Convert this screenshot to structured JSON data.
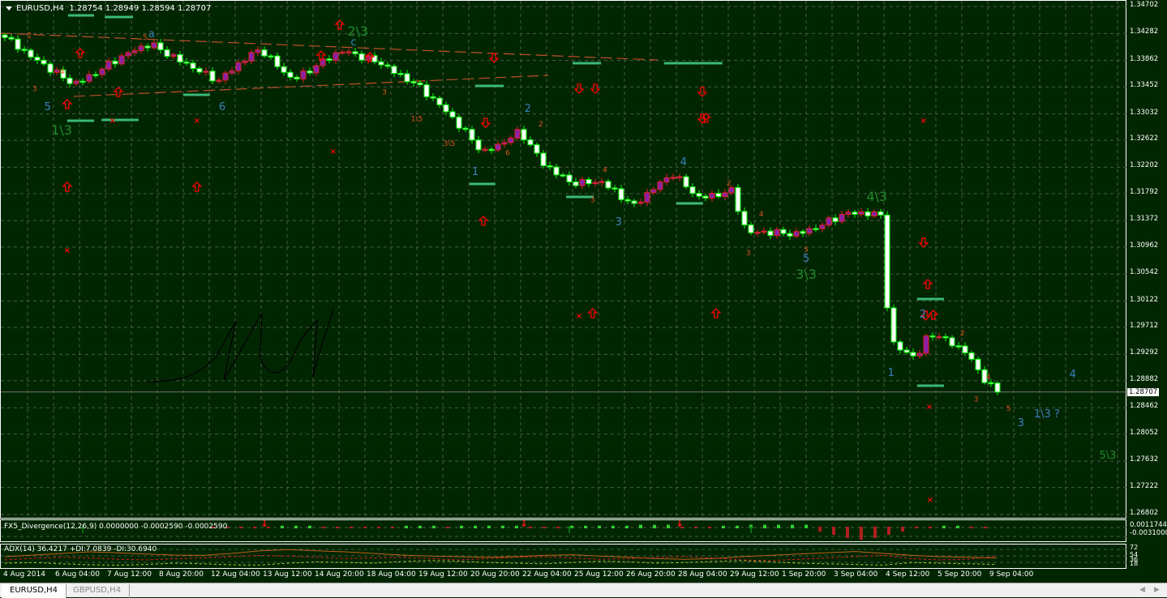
{
  "header": {
    "symbol": "EURUSD,H4",
    "ohlc": "1.28754 1.28949 1.28594 1.28707"
  },
  "price_axis": {
    "labels": [
      "1.34702",
      "1.34282",
      "1.33862",
      "1.33452",
      "1.33032",
      "1.32622",
      "1.32202",
      "1.31792",
      "1.31372",
      "1.30962",
      "1.30542",
      "1.30122",
      "1.29712",
      "1.29292",
      "1.28882",
      "1.28462",
      "1.28052",
      "1.27632",
      "1.27222",
      "1.26802"
    ],
    "current": "1.28707"
  },
  "divergence": {
    "label": "FX5_Divergence(12,26,9) 0.0000000 -0.0002590 -0.0002590",
    "axis": [
      "0.0011744",
      "-0.0031000"
    ],
    "hist": [
      0,
      -1,
      -1,
      0,
      -1,
      1,
      1,
      1,
      -1,
      -1,
      0,
      -1,
      -1,
      -1,
      1,
      1,
      1,
      0,
      1,
      1,
      1,
      1,
      1,
      -1,
      -1,
      -1,
      1,
      1,
      1,
      1,
      1,
      2,
      2,
      2,
      -1,
      -1,
      -1,
      1,
      1,
      2,
      2,
      2,
      2,
      2,
      -3,
      -5,
      -7,
      -8,
      -7,
      -5,
      -3,
      -1,
      0,
      1,
      1,
      -1,
      -1
    ],
    "arrows": [
      {
        "dir": "up",
        "bar": 12
      },
      {
        "dir": "down",
        "bar": 40
      },
      {
        "dir": "down",
        "bar": 80
      },
      {
        "dir": "up",
        "bar": 87
      },
      {
        "dir": "down",
        "bar": 104
      },
      {
        "dir": "up",
        "bar": 115
      }
    ]
  },
  "adx": {
    "label": "ADX(14) 36.4217 +DI:7.0839 -DI:30.6940",
    "axis": [
      "72",
      "54",
      "36",
      "18"
    ],
    "adx_line": [
      40,
      45,
      50,
      55,
      52,
      48,
      45,
      44,
      50,
      58,
      62,
      58,
      55,
      50,
      45,
      42,
      40,
      38,
      40,
      44,
      46,
      42,
      38,
      34,
      32,
      34,
      40,
      44,
      48,
      52,
      56,
      50,
      44,
      40,
      38,
      36
    ],
    "plus_di": [
      20,
      22,
      18,
      15,
      14,
      16,
      20,
      18,
      15,
      14,
      20,
      24,
      22,
      20,
      25,
      28,
      26,
      22,
      20,
      18,
      22,
      26,
      24,
      20,
      22,
      25,
      28,
      24,
      20,
      18,
      16,
      14,
      22,
      20,
      18,
      16
    ],
    "minus_di": [
      30,
      35,
      38,
      36,
      32,
      30,
      34,
      36,
      40,
      44,
      42,
      38,
      34,
      36,
      38,
      34,
      30,
      34,
      38,
      40,
      36,
      32,
      34,
      38,
      40,
      36,
      30,
      28,
      32,
      36,
      40,
      44,
      34,
      30,
      32,
      42
    ]
  },
  "time_axis": [
    "4 Aug 2014",
    "6 Aug 04:00",
    "7 Aug 12:00",
    "8 Aug 20:00",
    "12 Aug 04:00",
    "13 Aug 12:00",
    "14 Aug 20:00",
    "18 Aug 04:00",
    "19 Aug 12:00",
    "20 Aug 20:00",
    "22 Aug 04:00",
    "25 Aug 12:00",
    "26 Aug 20:00",
    "28 Aug 04:00",
    "29 Aug 12:00",
    "1 Sep 20:00",
    "3 Sep 04:00",
    "4 Sep 12:00",
    "5 Sep 20:00",
    "9 Sep 04:00"
  ],
  "tabs": [
    {
      "label": "EURUSD,H4",
      "active": true
    },
    {
      "label": "GBPUSD,H4",
      "active": false
    }
  ],
  "colors": {
    "bg": "#002600",
    "bull": "#8a1fa8",
    "bear": "#ffffff",
    "wick": "#00ff00",
    "grid": "#4a5a4a",
    "wave_blue": "#3e7fbf",
    "wave_green": "#1f8a2a",
    "minor": "#e0501a",
    "arrow": "#ff0000",
    "level": "#3cb878"
  },
  "chart_data": {
    "type": "candlestick",
    "ylim": [
      1.26802,
      1.34702
    ],
    "bars": 154,
    "close_anchors": [
      [
        0,
        1.3422
      ],
      [
        4.4,
        1.3385
      ],
      [
        10.6,
        1.3353
      ],
      [
        15.6,
        1.3378
      ],
      [
        22.5,
        1.341
      ],
      [
        28,
        1.3385
      ],
      [
        33,
        1.3353
      ],
      [
        39.4,
        1.3404
      ],
      [
        44.4,
        1.336
      ],
      [
        51.9,
        1.3397
      ],
      [
        58,
        1.3385
      ],
      [
        63,
        1.3353
      ],
      [
        68,
        1.3303
      ],
      [
        73.75,
        1.3246
      ],
      [
        79.4,
        1.3277
      ],
      [
        83,
        1.3221
      ],
      [
        87,
        1.3196
      ],
      [
        92,
        1.3202
      ],
      [
        97,
        1.3158
      ],
      [
        103,
        1.3209
      ],
      [
        107,
        1.3177
      ],
      [
        112,
        1.3183
      ],
      [
        114.4,
        1.3114
      ],
      [
        122,
        1.312
      ],
      [
        129.4,
        1.3145
      ],
      [
        135.4,
        1.3145
      ],
      [
        136.25,
        1.295
      ],
      [
        140.6,
        1.2928
      ],
      [
        142.5,
        1.2965
      ],
      [
        148,
        1.293
      ],
      [
        150.6,
        1.2894
      ],
      [
        153,
        1.28707
      ]
    ],
    "trendlines": [
      [
        [
          -0.6,
          1.34286
        ],
        [
          100.6,
          1.3387
        ]
      ],
      [
        [
          10.6,
          1.33304
        ],
        [
          83.75,
          1.33631
        ]
      ]
    ],
    "waves": [
      {
        "t": "1\\3",
        "c": "wave_green",
        "bar": 8.75,
        "p": 1.32774,
        "big": 1
      },
      {
        "t": "2\\3",
        "c": "wave_green",
        "bar": 54.4,
        "p": 1.34311,
        "big": 1
      },
      {
        "t": "3\\3",
        "c": "wave_green",
        "bar": 123.5,
        "p": 1.30532,
        "big": 1
      },
      {
        "t": "4\\3",
        "c": "wave_green",
        "bar": 134.4,
        "p": 1.31741,
        "big": 1
      },
      {
        "t": "5",
        "c": "wave_blue",
        "bar": 6.6,
        "p": 1.33152
      },
      {
        "t": "6",
        "c": "wave_blue",
        "bar": 33.5,
        "p": 1.33152
      },
      {
        "t": "1",
        "c": "wave_blue",
        "bar": 72.5,
        "p": 1.32144
      },
      {
        "t": "2",
        "c": "wave_blue",
        "bar": 80.6,
        "p": 1.33127
      },
      {
        "t": "3",
        "c": "wave_blue",
        "bar": 94.6,
        "p": 1.31363
      },
      {
        "t": "4",
        "c": "wave_blue",
        "bar": 104.6,
        "p": 1.32296
      },
      {
        "t": "5",
        "c": "wave_blue",
        "bar": 123.5,
        "p": 1.30796
      },
      {
        "t": "1",
        "c": "wave_blue",
        "bar": 136.6,
        "p": 1.2902
      },
      {
        "t": "2",
        "c": "wave_blue",
        "bar": 141.5,
        "p": 1.29927
      },
      {
        "t": "3",
        "c": "wave_blue",
        "bar": 156.6,
        "p": 1.28239
      },
      {
        "t": "4",
        "c": "wave_blue",
        "bar": 164.6,
        "p": 1.28995
      },
      {
        "t": "1\\3 ?",
        "c": "wave_blue",
        "bar": 160.6,
        "p": 1.28377
      },
      {
        "t": "a",
        "c": "wave_blue",
        "bar": 22.6,
        "p": 1.34286
      },
      {
        "t": "c",
        "c": "wave_blue",
        "bar": 53.75,
        "p": 1.3416
      },
      {
        "t": "5\\3",
        "c": "wave_green",
        "bar": 170,
        "p": 1.27735
      },
      {
        "t": "2",
        "c": "minor",
        "bar": 3.8,
        "p": 1.3428
      },
      {
        "t": "4",
        "c": "minor",
        "bar": 8.8,
        "p": 1.3372
      },
      {
        "t": "3",
        "c": "minor",
        "bar": 4.6,
        "p": 1.3345
      },
      {
        "t": "5",
        "c": "minor",
        "bar": 21.6,
        "p": 1.3425
      },
      {
        "t": "3",
        "c": "minor",
        "bar": 58.5,
        "p": 1.334
      },
      {
        "t": "1\\5",
        "c": "minor",
        "bar": 63.5,
        "p": 1.3298
      },
      {
        "t": "3\\5",
        "c": "minor",
        "bar": 68.5,
        "p": 1.326
      },
      {
        "t": "6",
        "c": "minor",
        "bar": 77.5,
        "p": 1.3245
      },
      {
        "t": "2",
        "c": "minor",
        "bar": 82.6,
        "p": 1.329
      },
      {
        "t": "4",
        "c": "minor",
        "bar": 92.5,
        "p": 1.3219
      },
      {
        "t": "3",
        "c": "minor",
        "bar": 90.6,
        "p": 1.3172
      },
      {
        "t": "2",
        "c": "minor",
        "bar": 111.6,
        "p": 1.3198
      },
      {
        "t": "4",
        "c": "minor",
        "bar": 116.6,
        "p": 1.315
      },
      {
        "t": "3",
        "c": "minor",
        "bar": 114.6,
        "p": 1.309
      },
      {
        "t": "5",
        "c": "minor",
        "bar": 123.5,
        "p": 1.3095
      },
      {
        "t": "2",
        "c": "minor",
        "bar": 147.6,
        "p": 1.2965
      },
      {
        "t": "4",
        "c": "minor",
        "bar": 151.6,
        "p": 1.2897
      },
      {
        "t": "3",
        "c": "minor",
        "bar": 149.7,
        "p": 1.2862
      },
      {
        "t": "5",
        "c": "minor",
        "bar": 154.7,
        "p": 1.2848
      }
    ],
    "levels": [
      [
        9.75,
        13.75,
        1.34563
      ],
      [
        15.4,
        19.75,
        1.34538
      ],
      [
        9.6,
        13.75,
        1.32926
      ],
      [
        14.9,
        20.6,
        1.32938
      ],
      [
        27.5,
        31.6,
        1.33329
      ],
      [
        72.5,
        76.9,
        1.33467
      ],
      [
        87.5,
        91.9,
        1.3382
      ],
      [
        101.6,
        110.6,
        1.3382
      ],
      [
        71.6,
        75.6,
        1.31943
      ],
      [
        86.5,
        90.75,
        1.31741
      ],
      [
        103.5,
        107.6,
        1.3164
      ],
      [
        140.6,
        144.75,
        1.30154
      ],
      [
        140.6,
        144.75,
        1.28806
      ]
    ],
    "up_arrows": [
      [
        51.6,
        1.34412
      ],
      [
        11.6,
        1.33971
      ],
      [
        48.75,
        1.33933
      ],
      [
        56.25,
        1.33908
      ],
      [
        9.6,
        1.33178
      ],
      [
        17.5,
        1.33366
      ],
      [
        9.6,
        1.31892
      ],
      [
        29.6,
        1.31892
      ],
      [
        73.75,
        1.31363
      ],
      [
        90.6,
        1.29927
      ],
      [
        109.6,
        1.29927
      ],
      [
        108.1,
        1.32963
      ],
      [
        142.25,
        1.3038
      ],
      [
        143.1,
        1.29902
      ]
    ],
    "down_arrows": [
      [
        75.4,
        1.33908
      ],
      [
        88.5,
        1.33429
      ],
      [
        91,
        1.33429
      ],
      [
        107.5,
        1.33379
      ],
      [
        107.5,
        1.32963
      ],
      [
        141.6,
        1.31036
      ],
      [
        74.1,
        1.329
      ],
      [
        141.9,
        1.29902
      ]
    ],
    "x_marks": [
      [
        9.6,
        1.3091
      ],
      [
        16.6,
        1.32926
      ],
      [
        29.6,
        1.32926
      ],
      [
        50.6,
        1.32447
      ],
      [
        88.5,
        1.29889
      ],
      [
        141.6,
        1.32926
      ],
      [
        142.5,
        1.28478
      ],
      [
        142.6,
        1.27029
      ]
    ]
  }
}
